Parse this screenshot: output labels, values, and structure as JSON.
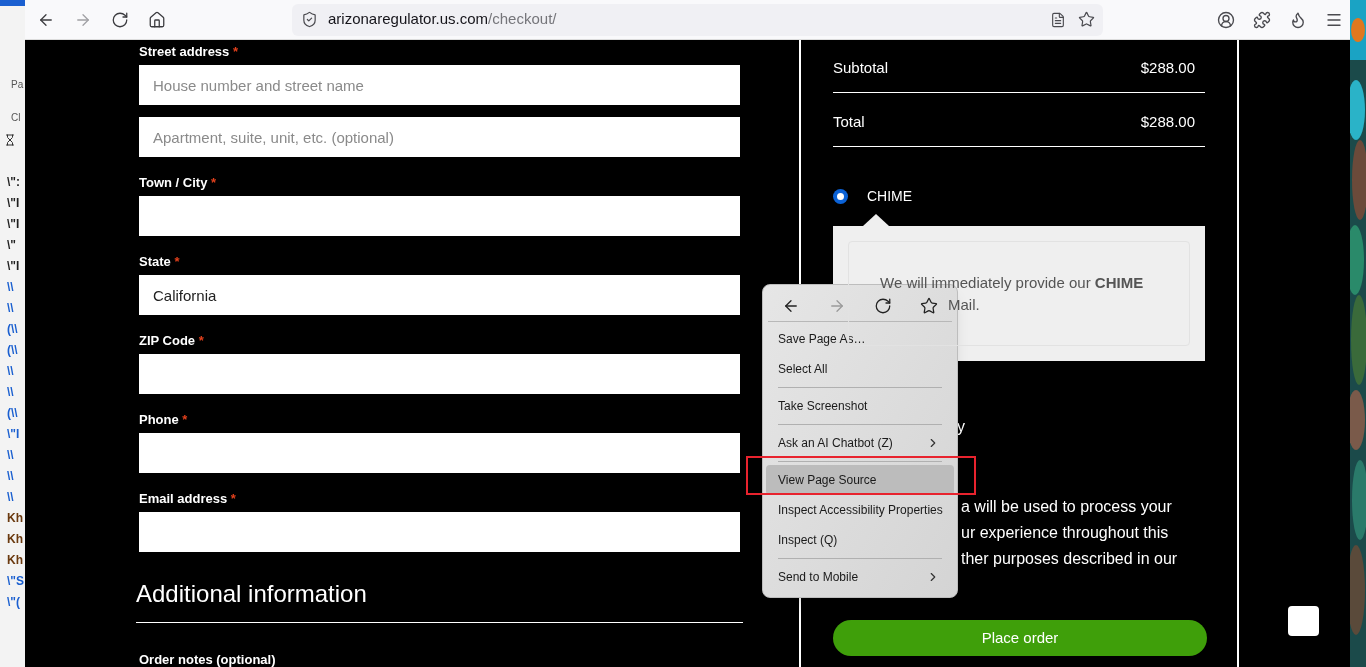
{
  "background_window": {
    "top_labels": [
      "Pa",
      "Cl"
    ],
    "lines": [
      {
        "text": "\\\":",
        "color": "#1f1f1f"
      },
      {
        "text": "\\\"I",
        "color": "#1f1f1f"
      },
      {
        "text": "\\\"I",
        "color": "#1f1f1f"
      },
      {
        "text": "\\\"",
        "color": "#1f1f1f"
      },
      {
        "text": "\\\"I",
        "color": "#1f1f1f"
      },
      {
        "text": "\\\\",
        "color": "#1a5fd0"
      },
      {
        "text": "\\\\",
        "color": "#1a5fd0"
      },
      {
        "text": "(\\\\",
        "color": "#1a5fd0"
      },
      {
        "text": "(\\\\",
        "color": "#1a5fd0"
      },
      {
        "text": "\\\\",
        "color": "#1a5fd0"
      },
      {
        "text": "\\\\",
        "color": "#1a5fd0"
      },
      {
        "text": "(\\\\",
        "color": "#1a5fd0"
      },
      {
        "text": "\\\"I",
        "color": "#1a5fd0"
      },
      {
        "text": "\\\\",
        "color": "#1a5fd0"
      },
      {
        "text": "\\\\",
        "color": "#1a5fd0"
      },
      {
        "text": "\\\\",
        "color": "#1a5fd0"
      },
      {
        "text": "Kh",
        "color": "#6b3a10"
      },
      {
        "text": "Kh",
        "color": "#6b3a10"
      },
      {
        "text": "Kh",
        "color": "#6b3a10"
      },
      {
        "text": "\\\"S",
        "color": "#1a5fd0"
      },
      {
        "text": "\\\"(",
        "color": "#1a5fd0"
      }
    ]
  },
  "toolbar": {
    "nav_buttons": [
      {
        "disabled": false
      },
      {
        "disabled": true
      },
      {
        "disabled": false
      },
      {
        "disabled": false
      }
    ],
    "url": {
      "host": "arizonaregulator.us.com",
      "path": "/checkout/"
    }
  },
  "form": {
    "fields": [
      {
        "label": "Street address",
        "required_mark": "*",
        "placeholder": "House number and street name"
      },
      {
        "placeholder": "Apartment, suite, unit, etc. (optional)"
      },
      {
        "label": "Town / City",
        "required_mark": "*"
      },
      {
        "label": "State",
        "required_mark": "*",
        "value": "California"
      },
      {
        "label": "ZIP Code",
        "required_mark": "*"
      },
      {
        "label": "Phone",
        "required_mark": "*"
      },
      {
        "label": "Email address",
        "required_mark": "*"
      }
    ],
    "section_heading": "Additional information",
    "notes_label": "Order notes (optional)"
  },
  "order_summary": {
    "rows": [
      {
        "label": "Subtotal",
        "amount": "$288.00"
      },
      {
        "label": "Total",
        "amount": "$288.00"
      }
    ],
    "payment_methods": [
      {
        "label": "CHIME",
        "selected": true
      }
    ],
    "payment_description": [
      "We will immediately provide our **CHIME**",
      "Mail."
    ],
    "fragment": "y",
    "privacy_lines": [
      "a will be used to process your",
      "ur experience throughout this",
      "ther purposes described in our"
    ],
    "place_order": "Place order"
  },
  "context_menu": {
    "nav_buttons": [
      {
        "disabled": false
      },
      {
        "disabled": true
      },
      {
        "disabled": false
      },
      {
        "disabled": false
      }
    ],
    "items": [
      {
        "kind": "item",
        "label": "Save Page As…",
        "selected": false,
        "submenu": false
      },
      {
        "kind": "item",
        "label": "Select All",
        "selected": false,
        "submenu": false
      },
      {
        "kind": "separator"
      },
      {
        "kind": "item",
        "label": "Take Screenshot",
        "selected": false,
        "submenu": false
      },
      {
        "kind": "separator"
      },
      {
        "kind": "item",
        "label": "Ask an AI Chatbot (Z)",
        "selected": false,
        "submenu": true
      },
      {
        "kind": "separator"
      },
      {
        "kind": "item",
        "label": "View Page Source",
        "selected": true,
        "submenu": false
      },
      {
        "kind": "item",
        "label": "Inspect Accessibility Properties",
        "selected": false,
        "submenu": false
      },
      {
        "kind": "item",
        "label": "Inspect (Q)",
        "selected": false,
        "submenu": false
      },
      {
        "kind": "separator"
      },
      {
        "kind": "item",
        "label": "Send to Mobile",
        "selected": false,
        "submenu": true
      }
    ]
  }
}
